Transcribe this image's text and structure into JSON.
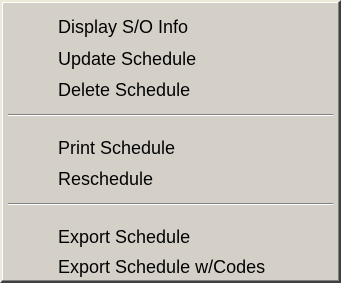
{
  "menu": {
    "group1": [
      {
        "label": "Display S/O Info"
      },
      {
        "label": "Update Schedule"
      },
      {
        "label": "Delete Schedule"
      }
    ],
    "group2": [
      {
        "label": "Print Schedule"
      },
      {
        "label": "Reschedule"
      }
    ],
    "group3": [
      {
        "label": "Export Schedule"
      },
      {
        "label": "Export Schedule w/Codes"
      }
    ]
  }
}
